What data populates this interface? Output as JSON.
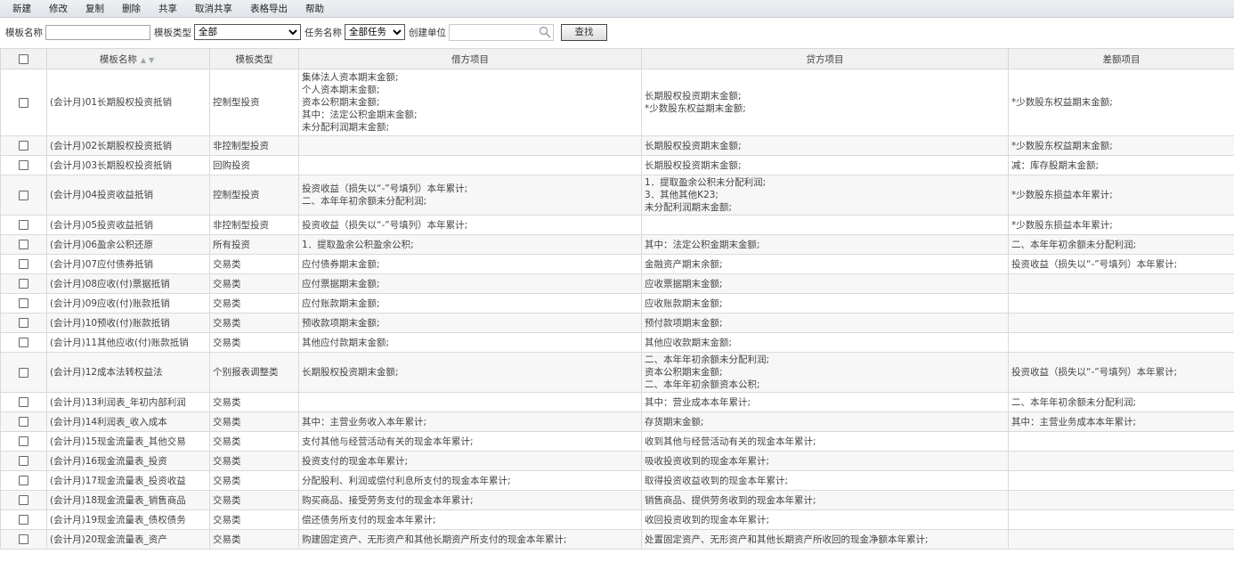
{
  "toolbar": {
    "buttons": [
      "新建",
      "修改",
      "复制",
      "删除",
      "共享",
      "取消共享",
      "表格导出",
      "帮助"
    ]
  },
  "search": {
    "name_label": "模板名称",
    "name_value": "",
    "type_label": "模板类型",
    "type_selected": "全部",
    "task_label": "任务名称",
    "task_selected": "全部任务",
    "unit_label": "创建单位",
    "unit_value": "",
    "find_label": "查找"
  },
  "table": {
    "headers": {
      "name": "模板名称",
      "type": "模板类型",
      "debit": "借方项目",
      "credit": "贷方项目",
      "diff": "差额项目"
    },
    "rows": [
      {
        "name": "(会计月)01长期股权投资抵销",
        "type": "控制型投资",
        "debit": [
          "集体法人资本期末金额;",
          "个人资本期末金额;",
          "资本公积期末金额;",
          "其中：法定公积金期末金额;",
          "未分配利润期末金额;"
        ],
        "credit": [
          "长期股权投资期末金额;",
          "*少数股东权益期末金额;"
        ],
        "diff": [
          "*少数股东权益期末金额;"
        ]
      },
      {
        "name": "(会计月)02长期股权投资抵销",
        "type": "非控制型投资",
        "debit": [],
        "credit": [
          "长期股权投资期末金额;"
        ],
        "diff": [
          "*少数股东权益期末金额;"
        ]
      },
      {
        "name": "(会计月)03长期股权投资抵销",
        "type": "回购投资",
        "debit": [],
        "credit": [
          "长期股权投资期末金额;"
        ],
        "diff": [
          "减：库存股期末金额;"
        ]
      },
      {
        "name": "(会计月)04投资收益抵销",
        "type": "控制型投资",
        "debit": [
          "投资收益（损失以“-”号填列）本年累计;",
          "二、本年年初余额未分配利润;"
        ],
        "credit": [
          "1．提取盈余公积未分配利润;",
          "3．其他其他K23;",
          "未分配利润期末金额;"
        ],
        "diff": [
          "*少数股东损益本年累计;"
        ]
      },
      {
        "name": "(会计月)05投资收益抵销",
        "type": "非控制型投资",
        "debit": [
          "投资收益（损失以“-”号填列）本年累计;"
        ],
        "credit": [],
        "diff": [
          "*少数股东损益本年累计;"
        ]
      },
      {
        "name": "(会计月)06盈余公积还原",
        "type": "所有投资",
        "debit": [
          "1．提取盈余公积盈余公积;"
        ],
        "credit": [
          "其中：法定公积金期末金额;"
        ],
        "diff": [
          "二、本年年初余额未分配利润;"
        ]
      },
      {
        "name": "(会计月)07应付债券抵销",
        "type": "交易类",
        "debit": [
          "应付债券期末金额;"
        ],
        "credit": [
          "金融资产期末余额;"
        ],
        "diff": [
          "投资收益（损失以“-”号填列）本年累计;"
        ]
      },
      {
        "name": "(会计月)08应收(付)票据抵销",
        "type": "交易类",
        "debit": [
          "应付票据期末金额;"
        ],
        "credit": [
          "应收票据期末金额;"
        ],
        "diff": []
      },
      {
        "name": "(会计月)09应收(付)账款抵销",
        "type": "交易类",
        "debit": [
          "应付账款期末金额;"
        ],
        "credit": [
          "应收账款期末金额;"
        ],
        "diff": []
      },
      {
        "name": "(会计月)10预收(付)账款抵销",
        "type": "交易类",
        "debit": [
          "预收款项期末金额;"
        ],
        "credit": [
          "预付款项期末金额;"
        ],
        "diff": []
      },
      {
        "name": "(会计月)11其他应收(付)账款抵销",
        "type": "交易类",
        "debit": [
          "其他应付款期末金额;"
        ],
        "credit": [
          "其他应收款期末金额;"
        ],
        "diff": []
      },
      {
        "name": "(会计月)12成本法转权益法",
        "type": "个别报表调整类",
        "debit": [
          "长期股权投资期末金额;"
        ],
        "credit": [
          "二、本年年初余额未分配利润;",
          "资本公积期末金额;",
          "二、本年年初余额资本公积;"
        ],
        "diff": [
          "投资收益（损失以“-”号填列）本年累计;"
        ]
      },
      {
        "name": "(会计月)13利润表_年初内部利润",
        "type": "交易类",
        "debit": [],
        "credit": [
          "其中：营业成本本年累计;"
        ],
        "diff": [
          "二、本年年初余额未分配利润;"
        ]
      },
      {
        "name": "(会计月)14利润表_收入成本",
        "type": "交易类",
        "debit": [
          "其中：主营业务收入本年累计;"
        ],
        "credit": [
          "存货期末金额;"
        ],
        "diff": [
          "其中：主营业务成本本年累计;"
        ]
      },
      {
        "name": "(会计月)15现金流量表_其他交易",
        "type": "交易类",
        "debit": [
          "支付其他与经营活动有关的现金本年累计;"
        ],
        "credit": [
          "收到其他与经营活动有关的现金本年累计;"
        ],
        "diff": []
      },
      {
        "name": "(会计月)16现金流量表_投资",
        "type": "交易类",
        "debit": [
          "投资支付的现金本年累计;"
        ],
        "credit": [
          "吸收投资收到的现金本年累计;"
        ],
        "diff": []
      },
      {
        "name": "(会计月)17现金流量表_投资收益",
        "type": "交易类",
        "debit": [
          "分配股利、利润或偿付利息所支付的现金本年累计;"
        ],
        "credit": [
          "取得投资收益收到的现金本年累计;"
        ],
        "diff": []
      },
      {
        "name": "(会计月)18现金流量表_销售商品",
        "type": "交易类",
        "debit": [
          "购买商品、接受劳务支付的现金本年累计;"
        ],
        "credit": [
          "销售商品、提供劳务收到的现金本年累计;"
        ],
        "diff": []
      },
      {
        "name": "(会计月)19现金流量表_债权债务",
        "type": "交易类",
        "debit": [
          "偿还债务所支付的现金本年累计;"
        ],
        "credit": [
          "收回投资收到的现金本年累计;"
        ],
        "diff": []
      },
      {
        "name": "(会计月)20现金流量表_资产",
        "type": "交易类",
        "debit": [
          "购建固定资产、无形资产和其他长期资产所支付的现金本年累计;"
        ],
        "credit": [
          "处置固定资产、无形资产和其他长期资产所收回的现金净额本年累计;"
        ],
        "diff": []
      }
    ]
  }
}
